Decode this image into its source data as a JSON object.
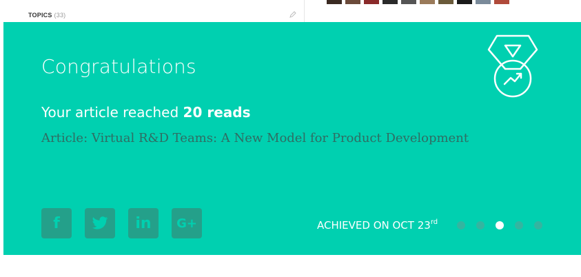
{
  "top": {
    "topics_label": "TOPICS",
    "topics_count": "(33)",
    "edit_icon": "pencil-icon",
    "avatar_colors": [
      "#3a2a22",
      "#6b4a3a",
      "#8a2a2a",
      "#2a2a2a",
      "#555555",
      "#9a7a5a",
      "#6a5a3a",
      "#1a1a1a",
      "#7a8a9a",
      "#b04a3a"
    ]
  },
  "card": {
    "background": "#00d0b0",
    "title": "Congratulations",
    "reads_prefix": "Your article reached ",
    "reads_value": "20 reads",
    "article": "Article: Virtual R&D Teams: A New Model for Product Development",
    "medal_icon": "medal-trending-up-icon",
    "social": [
      {
        "name": "facebook",
        "glyph": "f",
        "icon": "facebook-icon"
      },
      {
        "name": "twitter",
        "glyph": "🐦",
        "icon": "twitter-icon"
      },
      {
        "name": "linkedin",
        "glyph": "in",
        "icon": "linkedin-icon"
      },
      {
        "name": "google-plus",
        "glyph": "G+",
        "icon": "google-plus-icon"
      }
    ],
    "achieved_text": "ACHIEVED ON OCT 23",
    "achieved_suffix": "rd",
    "dots": {
      "count": 5,
      "active_index": 2
    }
  }
}
